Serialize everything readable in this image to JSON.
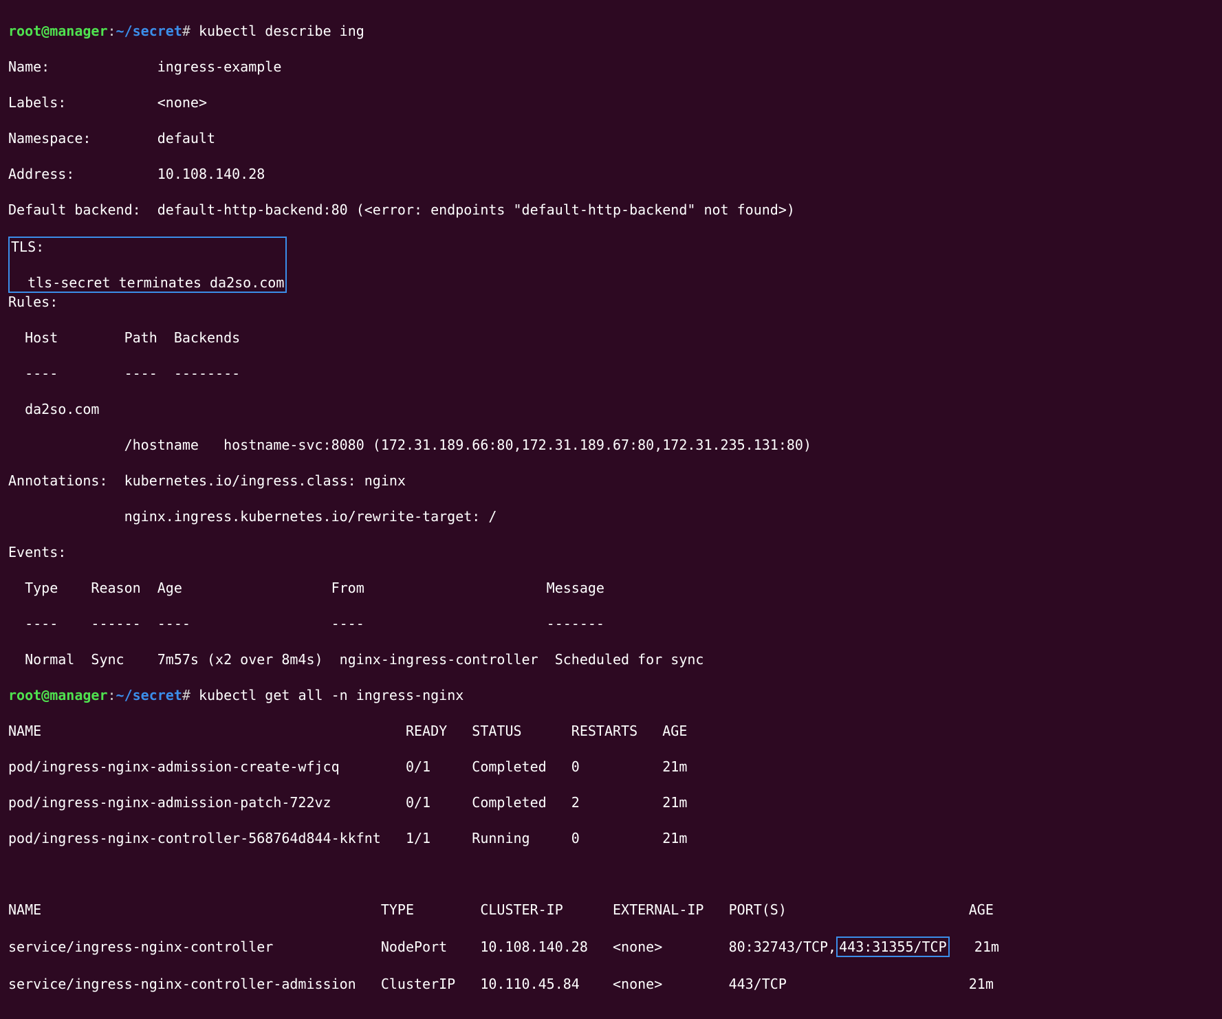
{
  "prompt1": {
    "user": "root@manager",
    "colon1": ":",
    "path": "~/secret",
    "hash": "#",
    "command": " kubectl describe ing"
  },
  "describe": {
    "name_line": "Name:             ingress-example",
    "labels_line": "Labels:           <none>",
    "ns_line": "Namespace:        default",
    "addr_line": "Address:          10.108.140.28",
    "defback_line": "Default backend:  default-http-backend:80 (<error: endpoints \"default-http-backend\" not found>)",
    "tls_header": "TLS:",
    "tls_body": "  tls-secret terminates da2so.com",
    "rules_header": "Rules:",
    "rules_cols": "  Host        Path  Backends",
    "rules_dash": "  ----        ----  --------",
    "rules_host": "  da2so.com",
    "rules_entry": "              /hostname   hostname-svc:8080 (172.31.189.66:80,172.31.189.67:80,172.31.235.131:80)",
    "ann_line1": "Annotations:  kubernetes.io/ingress.class: nginx",
    "ann_line2": "              nginx.ingress.kubernetes.io/rewrite-target: /",
    "events_header": "Events:",
    "events_cols": "  Type    Reason  Age                  From                      Message",
    "events_dash": "  ----    ------  ----                 ----                      -------",
    "events_row": "  Normal  Sync    7m57s (x2 over 8m4s)  nginx-ingress-controller  Scheduled for sync"
  },
  "prompt2": {
    "user": "root@manager",
    "colon1": ":",
    "path": "~/secret",
    "hash": "#",
    "command": " kubectl get all -n ingress-nginx"
  },
  "pods": {
    "header": "NAME                                            READY   STATUS      RESTARTS   AGE",
    "row1": "pod/ingress-nginx-admission-create-wfjcq        0/1     Completed   0          21m",
    "row2": "pod/ingress-nginx-admission-patch-722vz         0/1     Completed   2          21m",
    "row3": "pod/ingress-nginx-controller-568764d844-kkfnt   1/1     Running     0          21m"
  },
  "blank": "",
  "svc": {
    "header": "NAME                                         TYPE        CLUSTER-IP      EXTERNAL-IP   PORT(S)                      AGE",
    "row1_pre": "service/ingress-nginx-controller             NodePort    10.108.140.28   <none>        80:32743/TCP,",
    "row1_box": "443:31355/TCP",
    "row1_post": "   21m",
    "row2": "service/ingress-nginx-controller-admission   ClusterIP   10.110.45.84    <none>        443/TCP                      21m"
  }
}
